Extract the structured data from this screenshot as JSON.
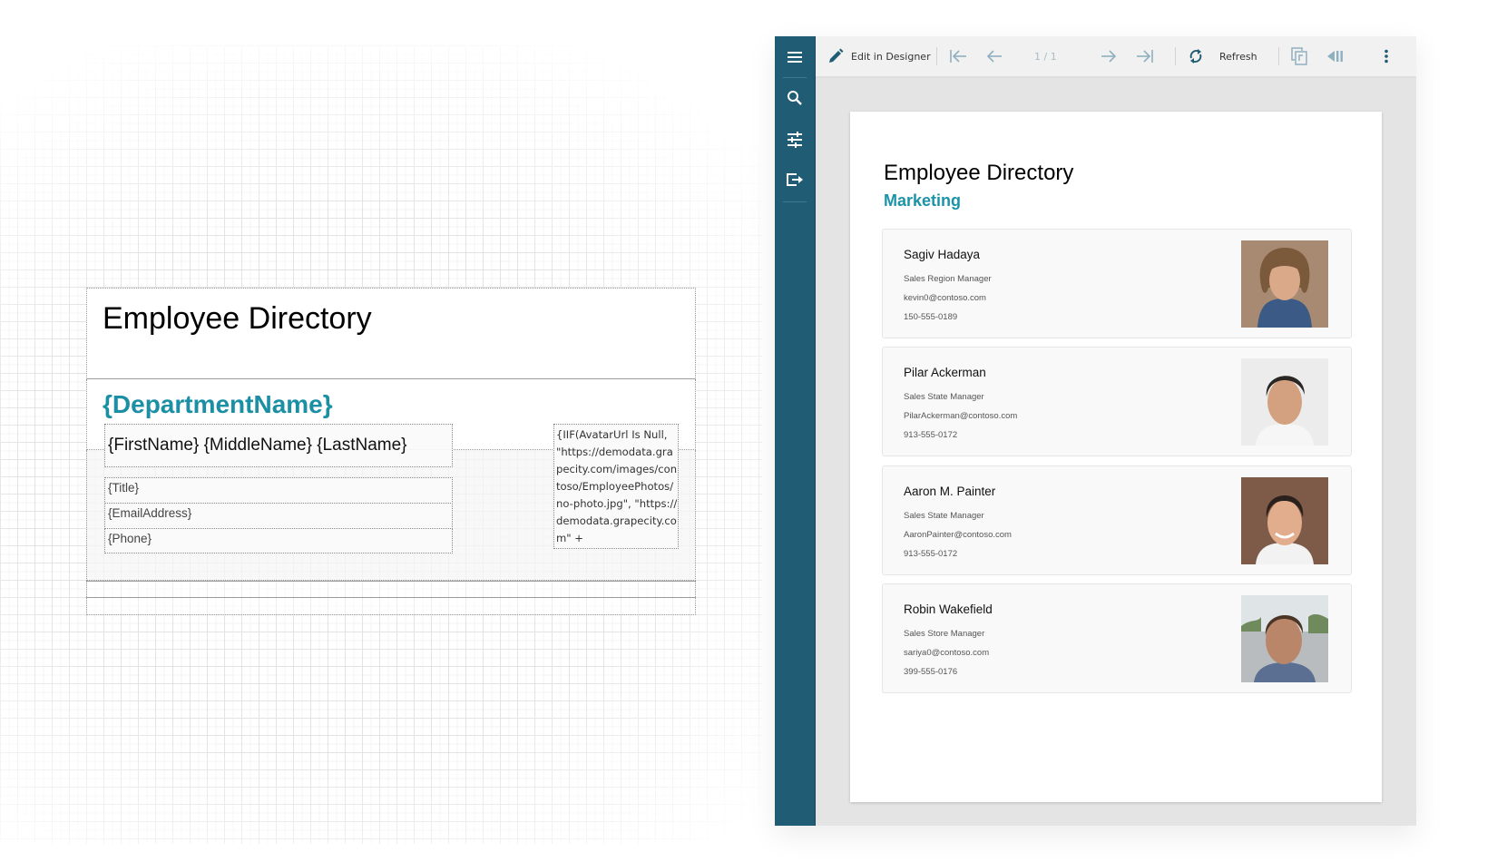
{
  "designer": {
    "title": "Employee Directory",
    "department_field": "{DepartmentName}",
    "name_field": "{FirstName} {MiddleName} {LastName}",
    "title_field": "{Title}",
    "email_field": "{EmailAddress}",
    "phone_field": "{Phone}",
    "image_expression": "{IIF(AvatarUrl Is Null, \"https://demodata.grapecity.com/images/contoso/EmployeePhotos/no-photo.jpg\", \"https://demodata.grapecity.com\" +"
  },
  "viewer": {
    "sidebar": {
      "items": [
        {
          "icon": "menu-icon"
        },
        {
          "icon": "search-icon"
        },
        {
          "icon": "parameters-icon"
        },
        {
          "icon": "export-icon"
        }
      ]
    },
    "toolbar": {
      "edit_label": "Edit in Designer",
      "page_indicator": "1 / 1",
      "refresh_label": "Refresh"
    },
    "colors": {
      "sidebar": "#205c73",
      "accent": "#1b93a8"
    },
    "report": {
      "title": "Employee Directory",
      "department": "Marketing",
      "employees": [
        {
          "name": "Sagiv Hadaya",
          "title": "Sales Region Manager",
          "email": "kevin0@contoso.com",
          "phone": "150-555-0189"
        },
        {
          "name": "Pilar Ackerman",
          "title": "Sales State Manager",
          "email": "PilarAckerman@contoso.com",
          "phone": "913-555-0172"
        },
        {
          "name": "Aaron M. Painter",
          "title": "Sales State Manager",
          "email": "AaronPainter@contoso.com",
          "phone": "913-555-0172"
        },
        {
          "name": "Robin Wakefield",
          "title": "Sales Store Manager",
          "email": "sariya0@contoso.com",
          "phone": "399-555-0176"
        }
      ]
    }
  }
}
